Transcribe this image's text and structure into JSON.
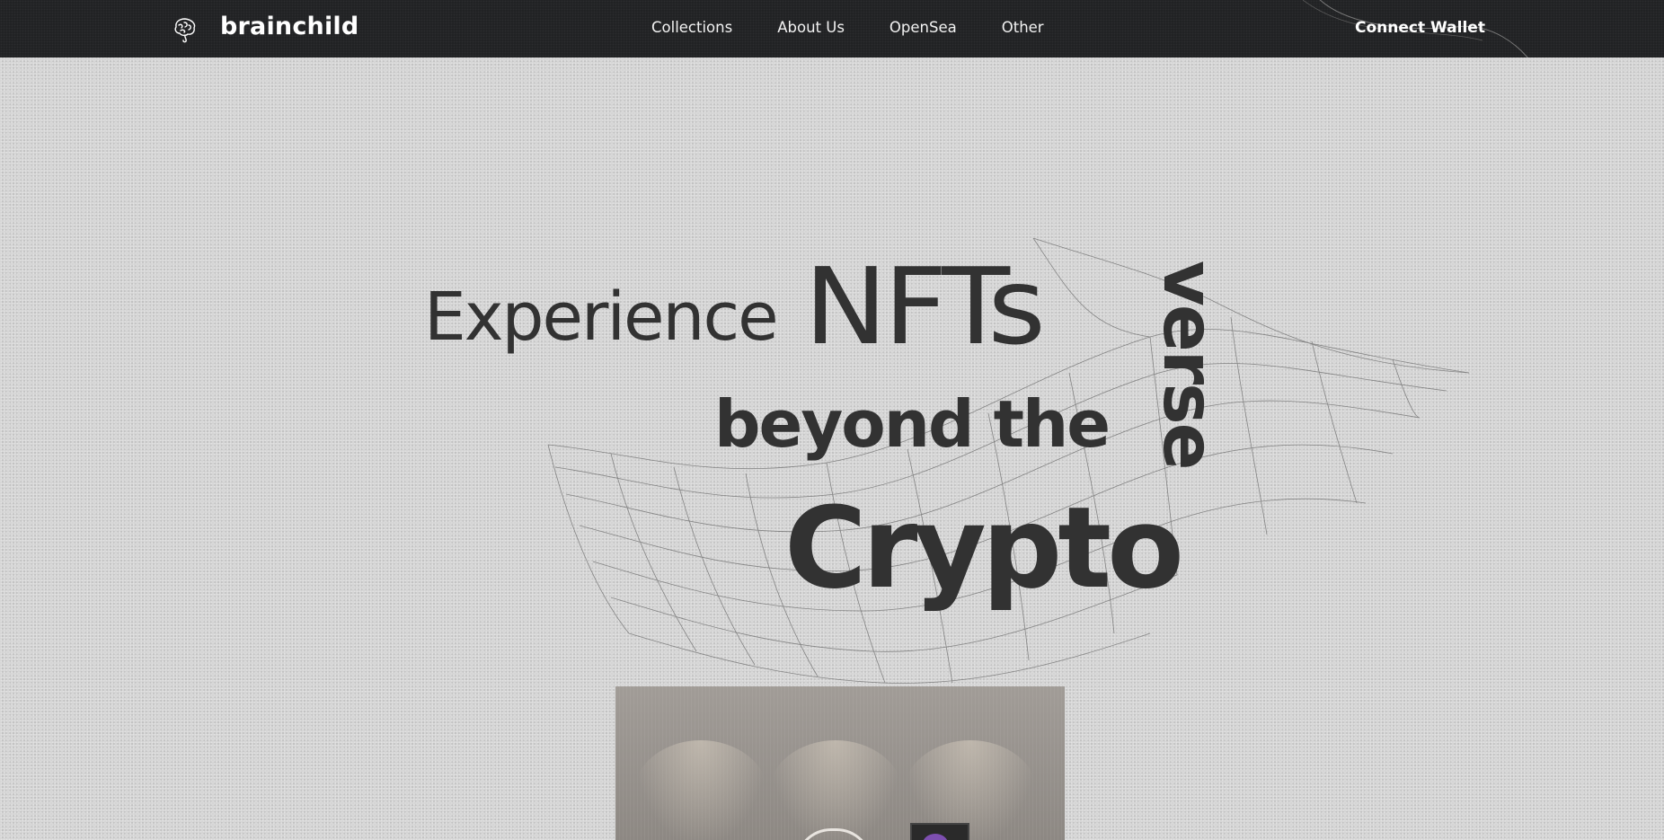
{
  "nav": {
    "brand": "brainchild",
    "links": [
      "Collections",
      "About Us",
      "OpenSea",
      "Other"
    ],
    "connect_wallet": "Connect Wallet"
  },
  "hero": {
    "line1_a": "Experience",
    "line1_b": "NFTs",
    "line2": "beyond the",
    "line3": "Crypto",
    "line4": "verse"
  },
  "icons": {
    "logo": "brain-icon"
  },
  "colors": {
    "nav_bg": "#1e1f21",
    "page_bg": "#d2d2d2",
    "hero_text": "#323232"
  }
}
